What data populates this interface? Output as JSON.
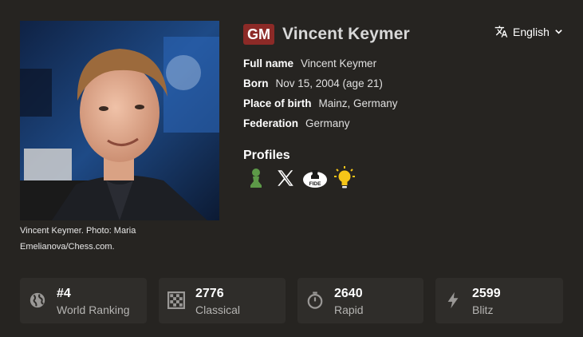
{
  "player": {
    "title": "GM",
    "name": "Vincent Keymer",
    "photo_caption": "Vincent Keymer. Photo: Maria Emelianova/Chess.com."
  },
  "language": {
    "label": "English",
    "icon": "translate-icon"
  },
  "info": [
    {
      "label": "Full name",
      "value": "Vincent Keymer"
    },
    {
      "label": "Born",
      "value": "Nov 15, 2004 (age 21)"
    },
    {
      "label": "Place of birth",
      "value": "Mainz, Germany"
    },
    {
      "label": "Federation",
      "value": "Germany"
    }
  ],
  "profiles": {
    "title": "Profiles",
    "links": [
      {
        "icon": "chesscom-pawn-icon",
        "color": "#5d9948"
      },
      {
        "icon": "x-icon",
        "color": "#ffffff"
      },
      {
        "icon": "fide-icon",
        "color": "#ffffff",
        "text": "FIDE"
      },
      {
        "icon": "lightbulb-icon",
        "color": "#f5c518"
      }
    ]
  },
  "stats": [
    {
      "icon": "globe-icon",
      "value": "#4",
      "label": "World Ranking"
    },
    {
      "icon": "classical-board-icon",
      "value": "2776",
      "label": "Classical"
    },
    {
      "icon": "stopwatch-icon",
      "value": "2640",
      "label": "Rapid"
    },
    {
      "icon": "lightning-icon",
      "value": "2599",
      "label": "Blitz"
    }
  ],
  "colors": {
    "background": "#262421",
    "stat_card": "#2f2d2a",
    "title_badge": "#8c2a27",
    "muted_text": "#b5b4b2"
  }
}
